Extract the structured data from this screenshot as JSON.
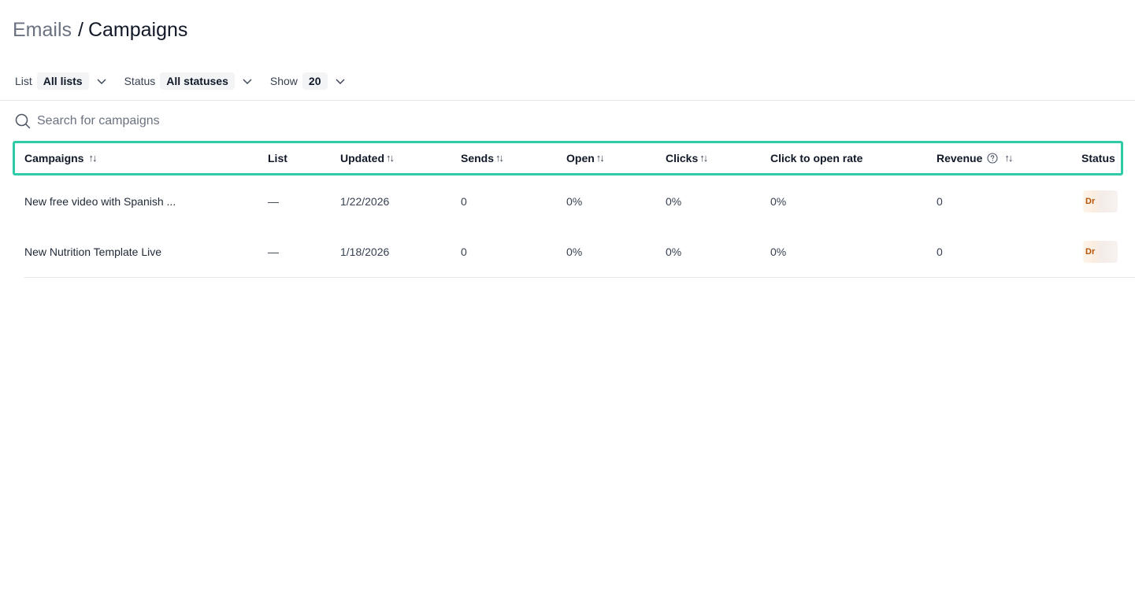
{
  "breadcrumb": {
    "parent": "Emails",
    "separator": "/",
    "current": "Campaigns"
  },
  "filters": {
    "list": {
      "label": "List",
      "value": "All lists"
    },
    "status": {
      "label": "Status",
      "value": "All statuses"
    },
    "show": {
      "label": "Show",
      "value": "20"
    }
  },
  "search": {
    "placeholder": "Search for campaigns",
    "value": ""
  },
  "table": {
    "columns": {
      "campaigns": "Campaigns",
      "list": "List",
      "updated": "Updated",
      "sends": "Sends",
      "open": "Open",
      "clicks": "Clicks",
      "click_to_open_rate": "Click to open rate",
      "revenue": "Revenue",
      "status": "Status"
    },
    "sort_glyph": "↑↓",
    "rows": [
      {
        "campaign": "New free video with Spanish ...",
        "list": "—",
        "updated": "1/22/2026",
        "sends": "0",
        "open": "0%",
        "clicks": "0%",
        "click_to_open_rate": "0%",
        "revenue": "0",
        "status": "Dr"
      },
      {
        "campaign": "New Nutrition Template Live",
        "list": "—",
        "updated": "1/18/2026",
        "sends": "0",
        "open": "0%",
        "clicks": "0%",
        "click_to_open_rate": "0%",
        "revenue": "0",
        "status": "Dr"
      }
    ]
  },
  "colors": {
    "header_highlight": "#2dcca7",
    "status_text": "#b45309",
    "muted_text": "#6b7280"
  },
  "icons": {
    "search": "search-icon",
    "dropdown": "chevron-down-icon",
    "sort": "sort-icon",
    "help": "help-circle-icon"
  }
}
